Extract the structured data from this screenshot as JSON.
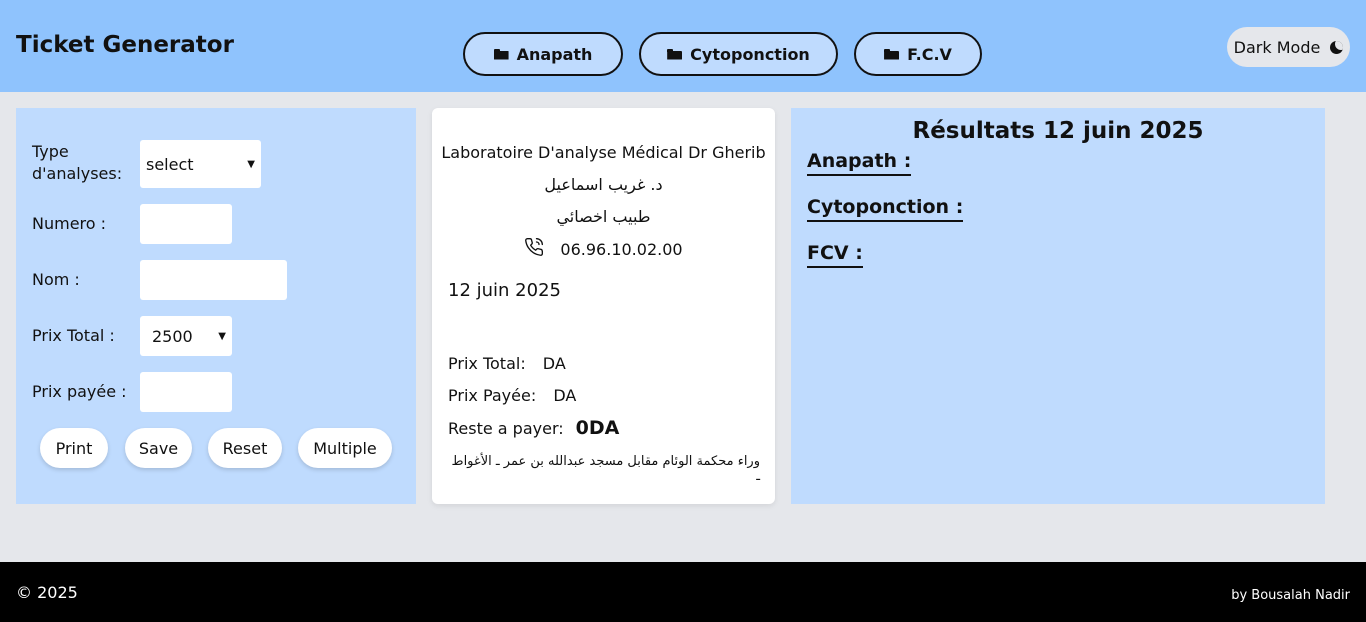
{
  "header": {
    "title": "Ticket Generator",
    "tabs": [
      {
        "label": "Anapath",
        "icon": "folder-open-icon"
      },
      {
        "label": "Cytoponction",
        "icon": "folder-open-icon"
      },
      {
        "label": "F.C.V",
        "icon": "folder-open-icon"
      }
    ],
    "dark_mode_label": "Dark Mode",
    "dark_mode_icon": "moon-icon"
  },
  "form": {
    "type_label": "Type d'analyses:",
    "type_value": "select",
    "numero_label": "Numero :",
    "numero_value": "",
    "nom_label": "Nom :",
    "nom_value": "",
    "prix_total_label": "Prix Total :",
    "prix_total_value": "2500",
    "prix_payee_label": "Prix payée :",
    "prix_payee_value": "",
    "buttons": {
      "print": "Print",
      "save": "Save",
      "reset": "Reset",
      "multiple": "Multiple"
    }
  },
  "ticket": {
    "lab_name": "Laboratoire D'analyse Médical Dr Gherib",
    "doctor_ar": "د. غريب اسماعيل",
    "specialty_ar": "طبيب اخصائي",
    "phone_icon": "phone-icon",
    "phone": "06.96.10.02.00",
    "date": "12 juin 2025",
    "prix_total_label": "Prix Total:",
    "prix_total_value": "DA",
    "prix_payee_label": "Prix Payée:",
    "prix_payee_value": "DA",
    "reste_label": "Reste a payer:",
    "reste_value": "0DA",
    "address_ar": "وراء محكمة الوئام مقابل مسجد عبدالله بن عمر ـ الأغواط ـ"
  },
  "results": {
    "title": "Résultats 12 juin 2025",
    "sections": [
      "Anapath :",
      "Cytoponction :",
      "FCV :"
    ]
  },
  "footer": {
    "copyright": "© 2025",
    "author": "by Bousalah Nadir"
  },
  "colors": {
    "header_bg": "#8fc3fd",
    "panel_bg": "#bfdbfe",
    "page_bg": "#e5e7eb",
    "footer_bg": "#000000"
  }
}
